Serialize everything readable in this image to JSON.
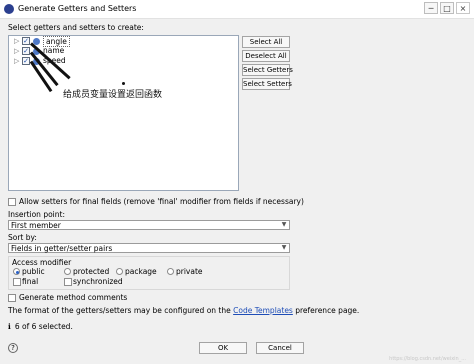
{
  "window": {
    "title": "Generate Getters and Setters",
    "minimize": "─",
    "maximize": "□",
    "close": "×"
  },
  "instructions": "Select getters and setters to create:",
  "tree": {
    "items": [
      {
        "label": "angle",
        "checked": true
      },
      {
        "label": "name",
        "checked": true
      },
      {
        "label": "speed",
        "checked": true
      }
    ]
  },
  "side_buttons": {
    "select_all": "Select All",
    "deselect_all": "Deselect All",
    "select_getters": "Select Getters",
    "select_setters": "Select Setters"
  },
  "options": {
    "allow_setters": "Allow setters for final fields (remove 'final' modifier from fields if necessary)",
    "insertion_point_label": "Insertion point:",
    "insertion_point_value": "First member",
    "sort_by_label": "Sort by:",
    "sort_by_value": "Fields in getter/setter pairs",
    "access_modifier_label": "Access modifier",
    "radios": [
      "public",
      "protected",
      "package",
      "private"
    ],
    "final_label": "final",
    "synchronized_label": "synchronized",
    "generate_comments": "Generate method comments"
  },
  "info": {
    "prefix": "The format of the getters/setters may be configured on the ",
    "link": "Code Templates",
    "suffix": " preference page.",
    "selected": "6 of 6 selected."
  },
  "footer": {
    "help": "?",
    "ok": "OK",
    "cancel": "Cancel",
    "watermark": "https://blog.csdn.net/weixin_..."
  },
  "annotation": {
    "text": "给成员变量设置返回函数"
  }
}
